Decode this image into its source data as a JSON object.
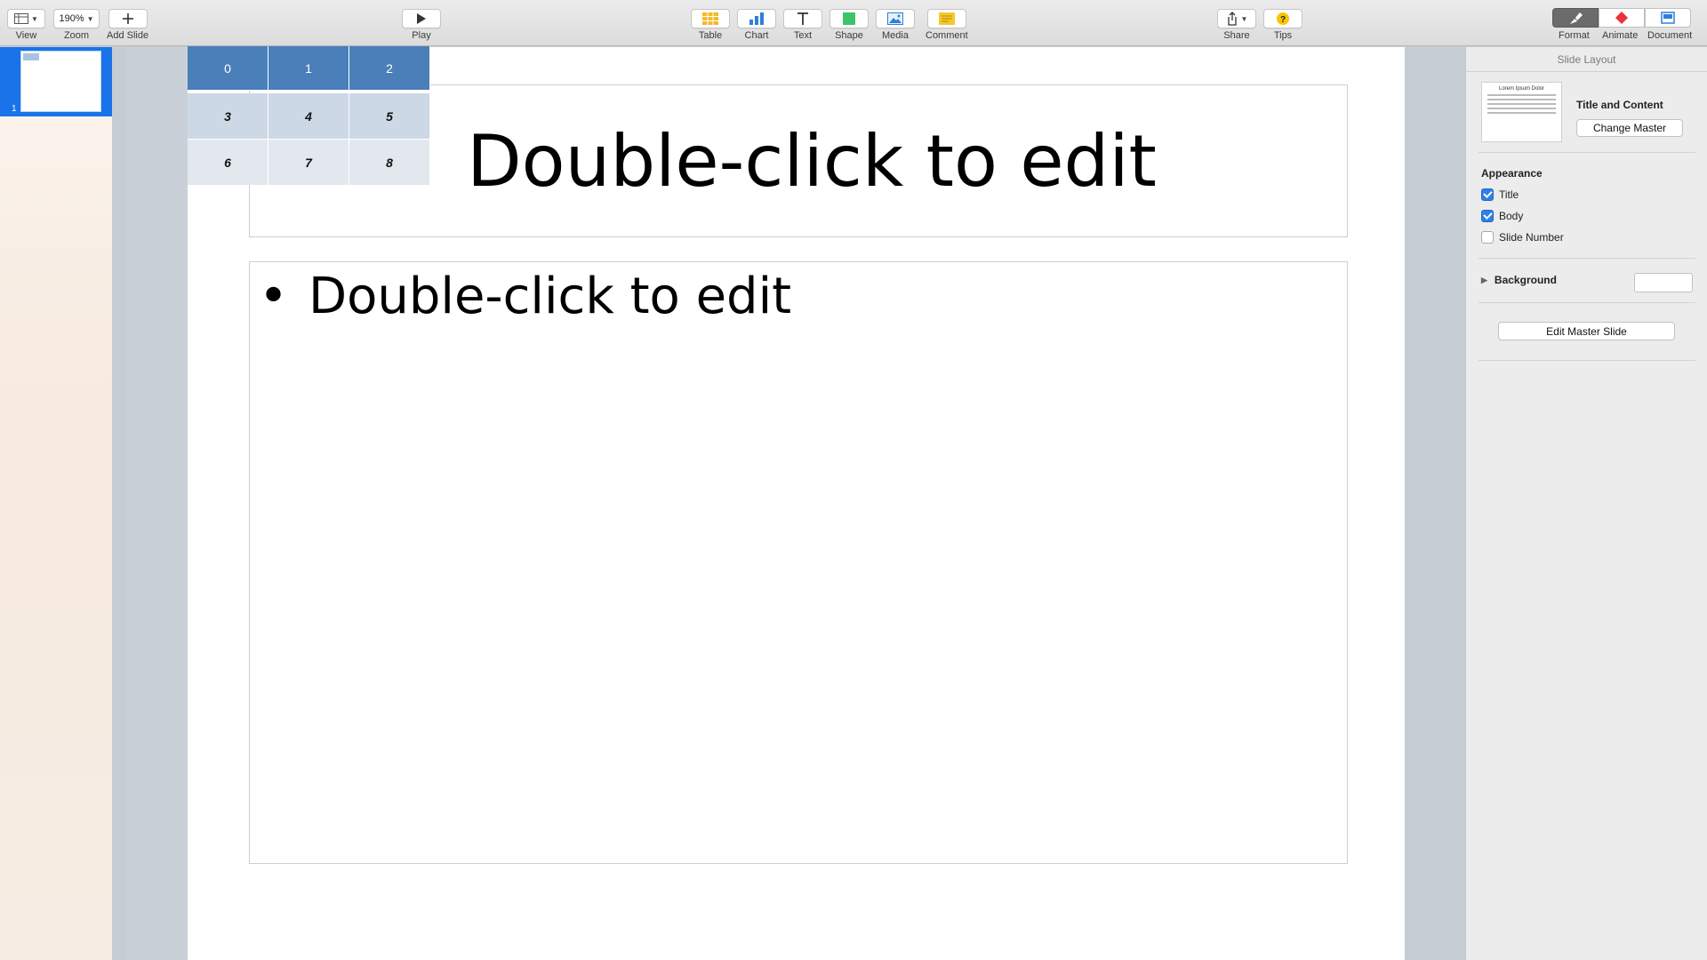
{
  "toolbar": {
    "view_label": "View",
    "zoom_value": "190%",
    "zoom_label": "Zoom",
    "add_slide_label": "Add Slide",
    "play_label": "Play",
    "table_label": "Table",
    "chart_label": "Chart",
    "text_label": "Text",
    "shape_label": "Shape",
    "media_label": "Media",
    "comment_label": "Comment",
    "share_label": "Share",
    "tips_label": "Tips",
    "format_label": "Format",
    "animate_label": "Animate",
    "document_label": "Document"
  },
  "navigator": {
    "slide_number": "1"
  },
  "slide": {
    "title_placeholder": "Double-click to edit",
    "bullet": "•",
    "body_placeholder": "Double-click to edit",
    "table": {
      "header": [
        "0",
        "1",
        "2"
      ],
      "rows": [
        [
          "3",
          "4",
          "5"
        ],
        [
          "6",
          "7",
          "8"
        ]
      ]
    }
  },
  "inspector": {
    "header": "Slide Layout",
    "master_thumb_title": "Lorem Ipsum Dolor",
    "layout_name": "Title and Content",
    "change_master_label": "Change Master",
    "appearance_title": "Appearance",
    "title_checkbox_label": "Title",
    "title_checked": true,
    "body_checkbox_label": "Body",
    "body_checked": true,
    "slide_number_checkbox_label": "Slide Number",
    "slide_number_checked": false,
    "background_label": "Background",
    "edit_master_label": "Edit Master Slide"
  },
  "colors": {
    "accent": "#1a73e8",
    "table_header": "#4a7fb9",
    "table_band": "#cdd8e6",
    "shape_green": "#3cc46a",
    "animate_red": "#e8323c",
    "tips_yellow": "#f7c600"
  },
  "icons": {
    "view": "sidebar-layout-icon",
    "add_slide": "plus-icon",
    "play": "play-icon",
    "table": "table-icon",
    "chart": "bar-chart-icon",
    "text": "text-t-icon",
    "shape": "square-shape-icon",
    "media": "image-icon",
    "comment": "comment-note-icon",
    "share": "share-icon",
    "tips": "question-icon",
    "format": "paintbrush-icon",
    "animate": "diamond-icon",
    "document": "document-icon"
  }
}
